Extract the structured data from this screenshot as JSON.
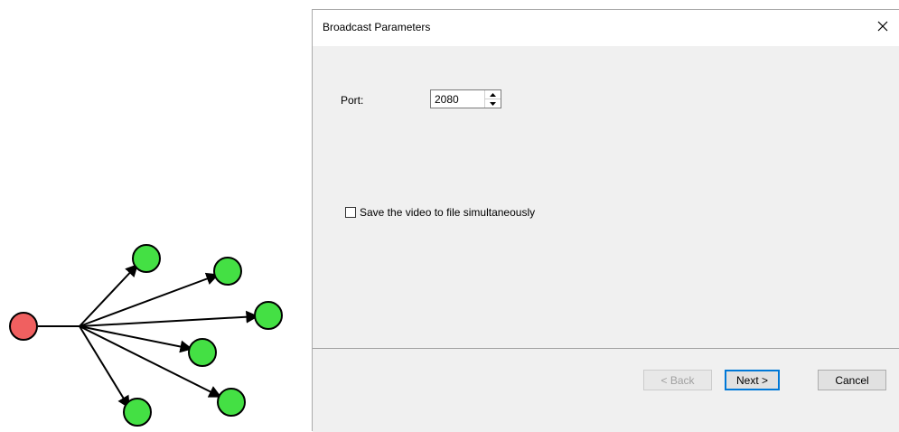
{
  "dialog": {
    "title": "Broadcast Parameters",
    "close_icon": "close-icon"
  },
  "form": {
    "port_label": "Port:",
    "port_value": "2080",
    "save_checkbox_label": "Save the video to file simultaneously",
    "save_checkbox_checked": false
  },
  "buttons": {
    "back": "< Back",
    "next": "Next >",
    "cancel": "Cancel"
  },
  "diagram": {
    "source_node_color": "#f06060",
    "target_node_color": "#44e044",
    "target_count": 6
  },
  "colors": {
    "accent": "#0078d7",
    "dialog_bg": "#f0f0f0"
  }
}
